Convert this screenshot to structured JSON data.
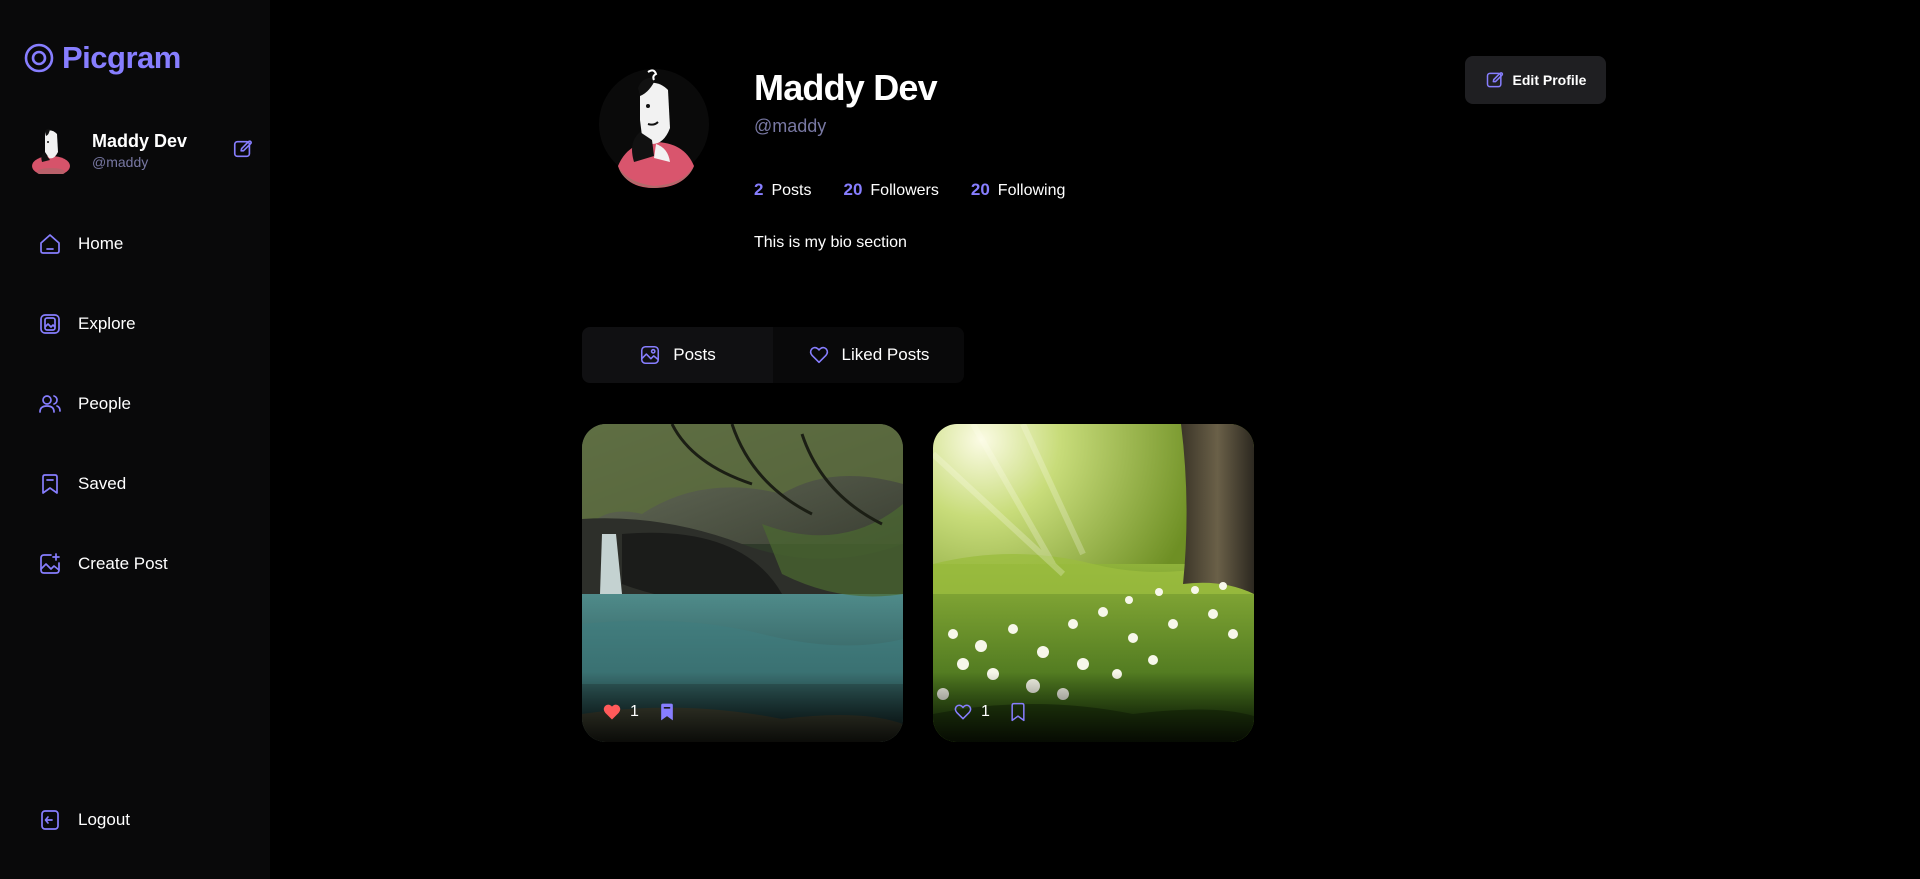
{
  "app": {
    "name": "Picgram"
  },
  "sidebar": {
    "user": {
      "name": "Maddy Dev",
      "handle": "@maddy"
    },
    "nav": [
      {
        "label": "Home",
        "icon": "home-icon"
      },
      {
        "label": "Explore",
        "icon": "explore-icon"
      },
      {
        "label": "People",
        "icon": "people-icon"
      },
      {
        "label": "Saved",
        "icon": "bookmark-icon"
      },
      {
        "label": "Create Post",
        "icon": "create-post-icon"
      }
    ],
    "logout_label": "Logout"
  },
  "profile": {
    "name": "Maddy Dev",
    "handle": "@maddy",
    "bio": "This is my bio section",
    "edit_label": "Edit Profile",
    "stats": [
      {
        "value": "2",
        "label": "Posts"
      },
      {
        "value": "20",
        "label": "Followers"
      },
      {
        "value": "20",
        "label": "Following"
      }
    ]
  },
  "tabs": [
    {
      "label": "Posts",
      "active": true
    },
    {
      "label": "Liked Posts",
      "active": false
    }
  ],
  "posts": [
    {
      "likes": "1",
      "liked": true,
      "saved": true,
      "scene": "waterfall"
    },
    {
      "likes": "1",
      "liked": false,
      "saved": false,
      "scene": "meadow"
    }
  ],
  "colors": {
    "accent": "#877eff",
    "muted": "#7878a3",
    "like": "#ff5a5a"
  }
}
